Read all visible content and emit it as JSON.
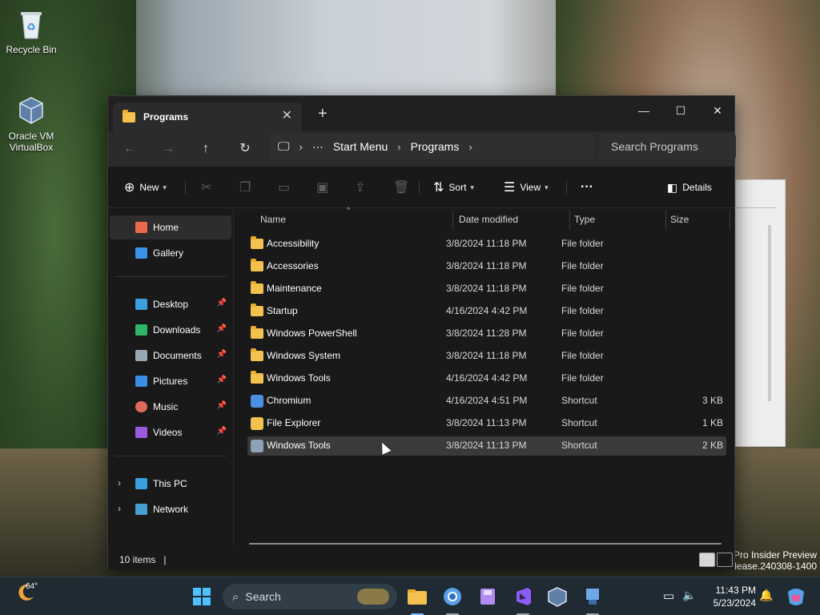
{
  "desktop": {
    "icons": [
      {
        "label": "Recycle Bin"
      },
      {
        "label": "Oracle VM\nVirtualBox"
      }
    ],
    "watermark": "Pro Insider Preview\nelease.240308-1400"
  },
  "window": {
    "tab_title": "Programs",
    "tab_close": "✕",
    "new_tab": "+",
    "controls": {
      "minimize": "—",
      "maximize": "☐",
      "close": "✕"
    },
    "nav": {
      "back": "←",
      "forward": "→",
      "up": "↑",
      "refresh": "↻"
    },
    "breadcrumb": {
      "computer_icon": "🖵",
      "overflow": "···",
      "items": [
        "Start Menu",
        "Programs"
      ],
      "sep": "›"
    },
    "search_placeholder": "Search Programs",
    "commands": {
      "new": "New",
      "sort": "Sort",
      "view": "View",
      "more": "···",
      "details": "Details"
    },
    "sidebar": {
      "top": [
        {
          "label": "Home",
          "selected": true,
          "color": "#e86a4a"
        },
        {
          "label": "Gallery",
          "selected": false,
          "color": "#3a93e8"
        }
      ],
      "pinned": [
        {
          "label": "Desktop",
          "color": "#3aa0e0"
        },
        {
          "label": "Downloads",
          "color": "#2fb56a"
        },
        {
          "label": "Documents",
          "color": "#9aa7b5"
        },
        {
          "label": "Pictures",
          "color": "#3a8ee6"
        },
        {
          "label": "Music",
          "color": "#e06a5a"
        },
        {
          "label": "Videos",
          "color": "#9a5ae0"
        }
      ],
      "pin_glyph": "📌",
      "bottom": [
        {
          "label": "This PC",
          "color": "#3aa0e0"
        },
        {
          "label": "Network",
          "color": "#46a0d0"
        }
      ],
      "chevron": "›"
    },
    "columns": {
      "name": "Name",
      "date": "Date modified",
      "type": "Type",
      "size": "Size"
    },
    "sort_caret": "^",
    "files": [
      {
        "name": "Accessibility",
        "date": "3/8/2024 11:18 PM",
        "type": "File folder",
        "size": "",
        "kind": "folder"
      },
      {
        "name": "Accessories",
        "date": "3/8/2024 11:18 PM",
        "type": "File folder",
        "size": "",
        "kind": "folder"
      },
      {
        "name": "Maintenance",
        "date": "3/8/2024 11:18 PM",
        "type": "File folder",
        "size": "",
        "kind": "folder"
      },
      {
        "name": "Startup",
        "date": "4/16/2024 4:42 PM",
        "type": "File folder",
        "size": "",
        "kind": "folder"
      },
      {
        "name": "Windows PowerShell",
        "date": "3/8/2024 11:28 PM",
        "type": "File folder",
        "size": "",
        "kind": "folder"
      },
      {
        "name": "Windows System",
        "date": "3/8/2024 11:18 PM",
        "type": "File folder",
        "size": "",
        "kind": "folder"
      },
      {
        "name": "Windows Tools",
        "date": "4/16/2024 4:42 PM",
        "type": "File folder",
        "size": "",
        "kind": "folder"
      },
      {
        "name": "Chromium",
        "date": "4/16/2024 4:51 PM",
        "type": "Shortcut",
        "size": "3 KB",
        "kind": "chromium"
      },
      {
        "name": "File Explorer",
        "date": "3/8/2024 11:13 PM",
        "type": "Shortcut",
        "size": "1 KB",
        "kind": "explorer"
      },
      {
        "name": "Windows Tools",
        "date": "3/8/2024 11:13 PM",
        "type": "Shortcut",
        "size": "2 KB",
        "kind": "tools",
        "selected": true
      }
    ],
    "status": "10 items",
    "status_caret": "|"
  },
  "taskbar": {
    "weather_temp": "64°",
    "search_label": "Search",
    "time": "11:43 PM",
    "date": "5/23/2024"
  },
  "colors": {
    "accent": "#7ab7ff",
    "folder": "#f2c14e"
  }
}
